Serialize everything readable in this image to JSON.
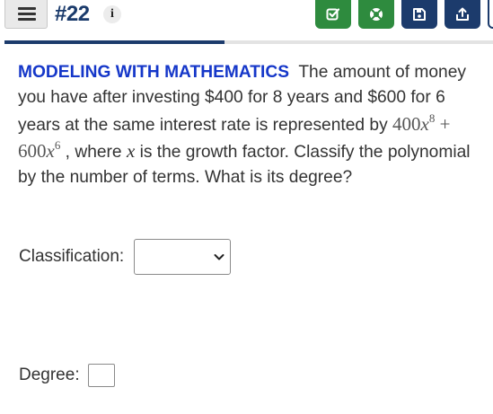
{
  "header": {
    "question_number": "#22",
    "info_icon": "i"
  },
  "toolbar": {
    "buttons": [
      {
        "icon": "check-box-icon",
        "color": "#2e8b3e"
      },
      {
        "icon": "lifebuoy-icon",
        "color": "#2e8b3e"
      },
      {
        "icon": "save-icon",
        "color": "#1c3b6c"
      },
      {
        "icon": "share-icon",
        "color": "#1c3b6c"
      }
    ]
  },
  "progress": {
    "fraction": 0.45,
    "color": "#1c3b6c"
  },
  "problem": {
    "lead": "MODELING WITH MATHEMATICS",
    "text_1": "The amount of money you have after investing $400 for 8 years and $600 for 6 years at the same interest rate is represented by",
    "term1_coef": "400",
    "term1_var": "x",
    "term1_exp": "8",
    "plus": "+",
    "term2_coef": "600",
    "term2_var": "x",
    "term2_exp": "6",
    "text_2": ", where",
    "variable": "x",
    "text_3": "is the growth factor. Classify the polynomial by the number of terms. What is its degree?"
  },
  "answers": {
    "classification_label": "Classification:",
    "classification_value": "",
    "degree_label": "Degree:",
    "degree_value": ""
  },
  "colors": {
    "lead": "#1537c9",
    "navy": "#1c3b6c",
    "green": "#2e8b3e"
  }
}
